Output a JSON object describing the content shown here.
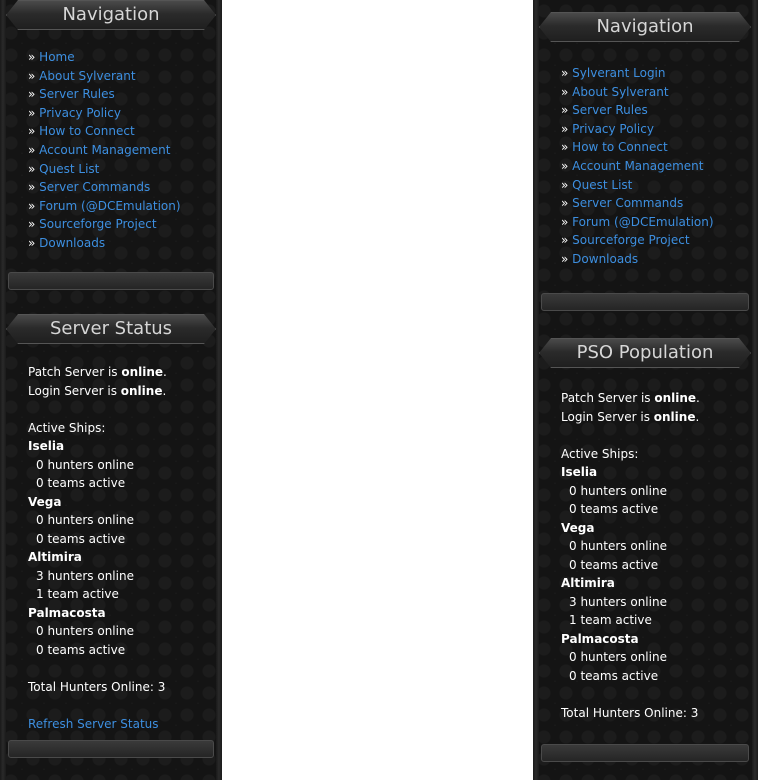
{
  "left": {
    "nav_title": "Navigation",
    "nav_items": [
      "Home",
      "About Sylverant",
      "Server Rules",
      "Privacy Policy",
      "How to Connect",
      "Account Management",
      "Quest List",
      "Server Commands",
      "Forum (@DCEmulation)",
      "Sourceforge Project",
      "Downloads"
    ],
    "status_title": "Server Status",
    "patch_prefix": "Patch Server is ",
    "patch_state": "online",
    "login_prefix": "Login Server is ",
    "login_state": "online",
    "period": ".",
    "active_ships_label": "Active Ships:",
    "ships": [
      {
        "name": "Iselia",
        "hunters": "0 hunters online",
        "teams": "0 teams active"
      },
      {
        "name": "Vega",
        "hunters": "0 hunters online",
        "teams": "0 teams active"
      },
      {
        "name": "Altimira",
        "hunters": "3 hunters online",
        "teams": "1 team active"
      },
      {
        "name": "Palmacosta",
        "hunters": "0 hunters online",
        "teams": "0 teams active"
      }
    ],
    "total": "Total Hunters Online: 3",
    "refresh": "Refresh Server Status"
  },
  "right": {
    "nav_title": "Navigation",
    "nav_items": [
      "Sylverant Login",
      "About Sylverant",
      "Server Rules",
      "Privacy Policy",
      "How to Connect",
      "Account Management",
      "Quest List",
      "Server Commands",
      "Forum (@DCEmulation)",
      "Sourceforge Project",
      "Downloads"
    ],
    "status_title": "PSO Population",
    "patch_prefix": "Patch Server is ",
    "patch_state": "online",
    "login_prefix": "Login Server is ",
    "login_state": "online",
    "period": ".",
    "active_ships_label": "Active Ships:",
    "ships": [
      {
        "name": "Iselia",
        "hunters": "0 hunters online",
        "teams": "0 teams active"
      },
      {
        "name": "Vega",
        "hunters": "0 hunters online",
        "teams": "0 teams active"
      },
      {
        "name": "Altimira",
        "hunters": "3 hunters online",
        "teams": "1 team active"
      },
      {
        "name": "Palmacosta",
        "hunters": "0 hunters online",
        "teams": "0 teams active"
      }
    ],
    "total": "Total Hunters Online: 3"
  },
  "bullet": "»",
  "colors": {
    "link": "#3d8fe0",
    "panel_bg": "#141414",
    "page_bg": "#ffffff"
  }
}
